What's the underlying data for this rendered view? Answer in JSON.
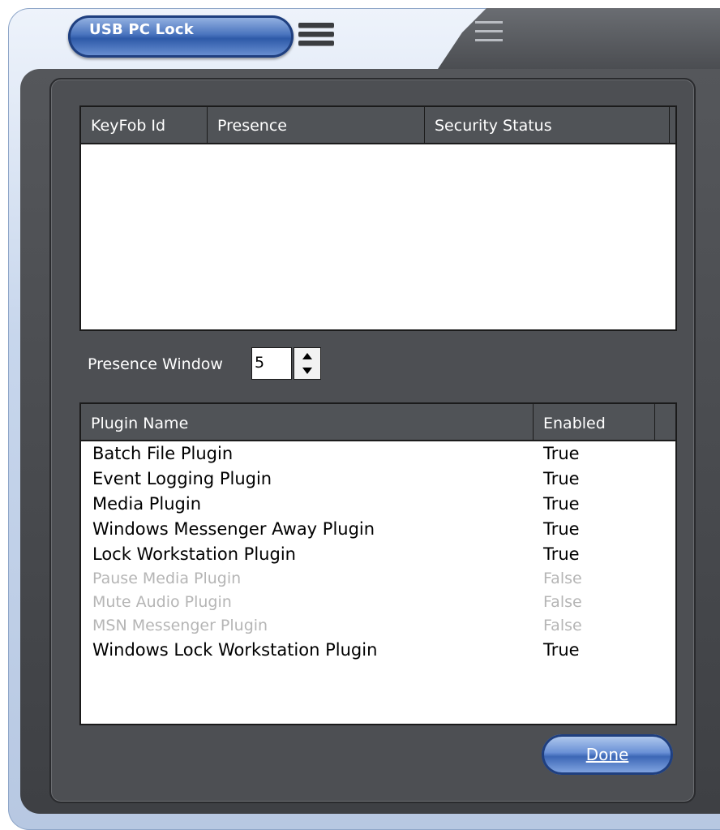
{
  "window": {
    "title": "USB PC Lock"
  },
  "keyfob_table": {
    "columns": [
      "KeyFob Id",
      "Presence",
      "Security Status"
    ],
    "rows": []
  },
  "presence": {
    "label": "Presence Window",
    "value": "5"
  },
  "plugin_table": {
    "columns": [
      "Plugin Name",
      "Enabled"
    ],
    "rows": [
      {
        "name": "Batch File Plugin",
        "enabled": "True"
      },
      {
        "name": "Event Logging Plugin",
        "enabled": "True"
      },
      {
        "name": "Media Plugin",
        "enabled": "True"
      },
      {
        "name": "Windows Messenger Away Plugin",
        "enabled": "True"
      },
      {
        "name": "Lock Workstation Plugin",
        "enabled": "True"
      },
      {
        "name": "Pause Media Plugin",
        "enabled": "False"
      },
      {
        "name": "Mute Audio Plugin",
        "enabled": "False"
      },
      {
        "name": "MSN Messenger Plugin",
        "enabled": "False"
      },
      {
        "name": "Windows Lock Workstation Plugin",
        "enabled": "True"
      }
    ]
  },
  "buttons": {
    "done": "Done"
  },
  "icons": {
    "menu": "menu-icon",
    "spin_up": "spin-up-icon",
    "spin_down": "spin-down-icon"
  },
  "colors": {
    "frame": "#4d4f53",
    "accent": "#2e5aa8",
    "disabled_text": "#b5b5b5"
  }
}
